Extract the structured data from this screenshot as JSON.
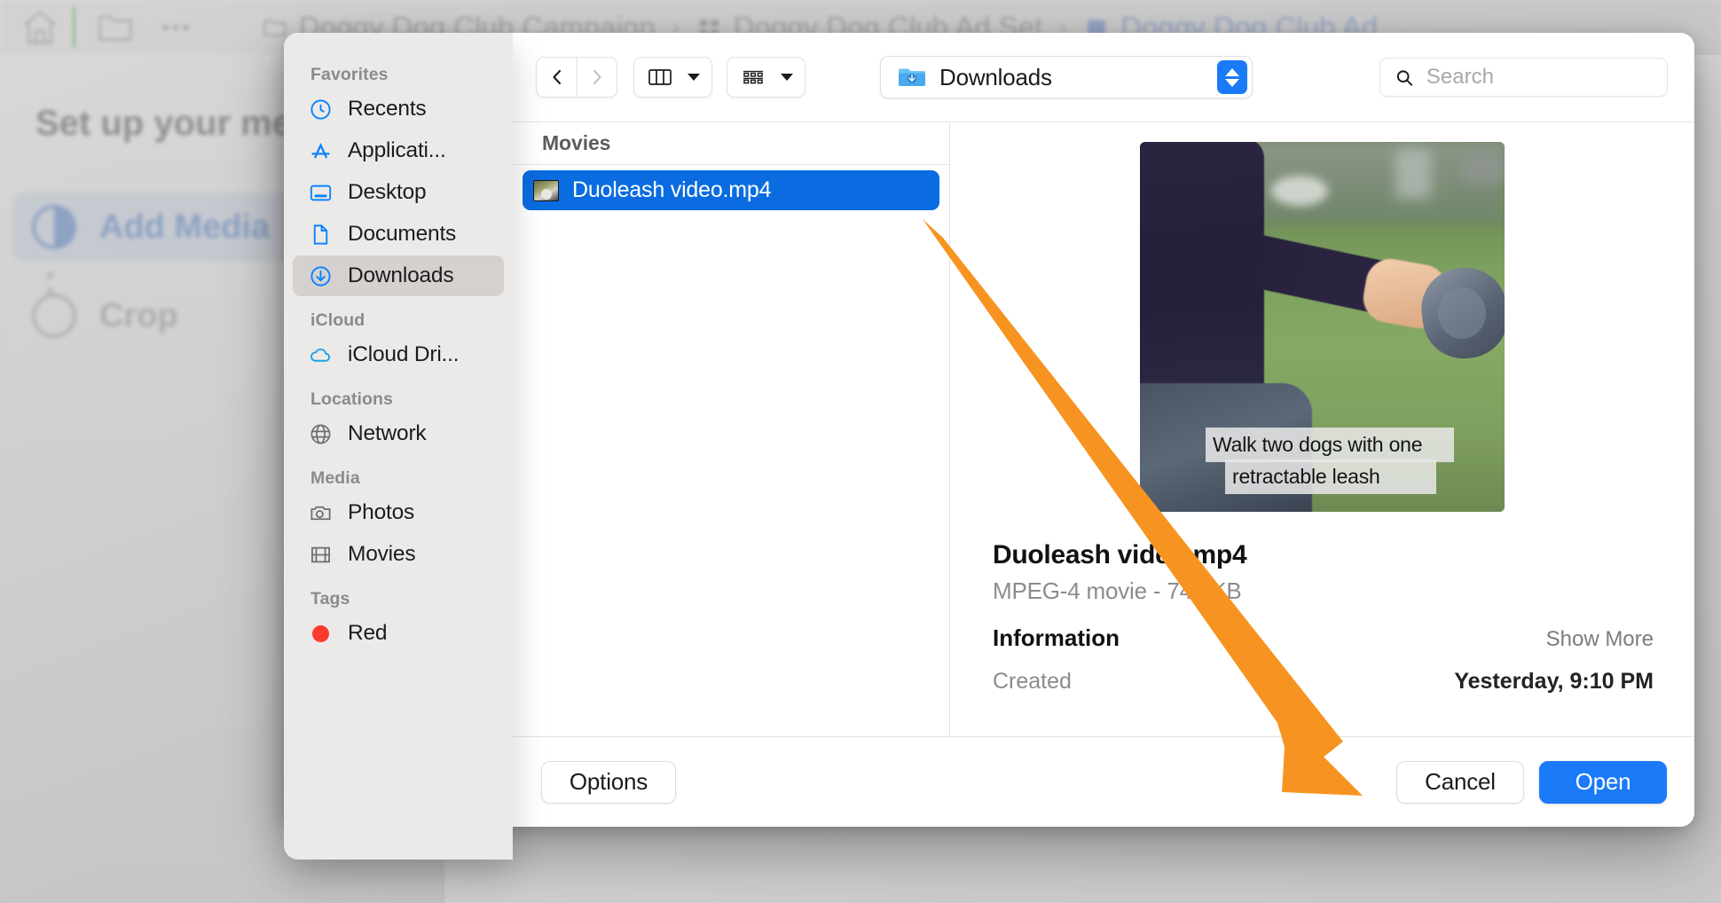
{
  "background_app": {
    "breadcrumb": [
      {
        "label": "Doggy Dog Club Campaign",
        "icon": "folder-icon"
      },
      {
        "label": "Doggy Dog Club Ad Set",
        "icon": "grid-icon"
      },
      {
        "label": "Doggy Dog Club Ad",
        "icon": "ad-icon"
      }
    ],
    "separator": "›",
    "panel_title": "Set up your med",
    "steps": [
      {
        "label": "Add Media",
        "state": "active"
      },
      {
        "label": "Crop",
        "state": "inactive"
      }
    ]
  },
  "dialog": {
    "sidebar": {
      "groups": [
        {
          "title": "Favorites",
          "items": [
            {
              "label": "Recents",
              "icon": "clock-icon",
              "active": false
            },
            {
              "label": "Applicati...",
              "icon": "appstore-icon",
              "active": false
            },
            {
              "label": "Desktop",
              "icon": "desktop-icon",
              "active": false
            },
            {
              "label": "Documents",
              "icon": "document-icon",
              "active": false
            },
            {
              "label": "Downloads",
              "icon": "download-icon",
              "active": true
            }
          ]
        },
        {
          "title": "iCloud",
          "items": [
            {
              "label": "iCloud Dri...",
              "icon": "cloud-icon",
              "active": false
            }
          ]
        },
        {
          "title": "Locations",
          "items": [
            {
              "label": "Network",
              "icon": "globe-icon",
              "active": false
            }
          ]
        },
        {
          "title": "Media",
          "items": [
            {
              "label": "Photos",
              "icon": "camera-icon",
              "active": false
            },
            {
              "label": "Movies",
              "icon": "film-icon",
              "active": false
            }
          ]
        },
        {
          "title": "Tags",
          "items": [
            {
              "label": "Red",
              "icon": "red-tag-dot",
              "active": false
            }
          ]
        }
      ]
    },
    "toolbar": {
      "back_icon": "chevron-left-icon",
      "forward_icon": "chevron-right-icon",
      "view_mode_icon": "column-view-icon",
      "view_mode_chevron": "chevron-down-icon",
      "group_by_icon": "group-by-icon",
      "group_by_chevron": "chevron-down-icon",
      "path_label": "Downloads",
      "path_icon": "downloads-folder-icon",
      "path_stepper_icon": "up-down-stepper-icon",
      "search_icon": "search-icon",
      "search_value": "",
      "search_placeholder": "Search"
    },
    "file_list": {
      "column_header": "Movies",
      "rows": [
        {
          "name": "Duoleash video.mp4",
          "icon": "video-thumbnail-icon",
          "selected": true
        }
      ]
    },
    "preview": {
      "media_caption_line1": "Walk two dogs with one",
      "media_caption_line2": "retractable leash",
      "file_name": "Duoleash video.mp4",
      "file_meta": "MPEG-4 movie - 748 KB",
      "section_title": "Information",
      "show_more": "Show More",
      "info_rows": [
        {
          "key": "Created",
          "value": "Yesterday, 9:10 PM"
        }
      ]
    },
    "buttons": {
      "options": "Options",
      "cancel": "Cancel",
      "open": "Open"
    }
  },
  "annotation": {
    "arrow_color": "#F79421",
    "arrow_points_to": "Open"
  },
  "colors": {
    "accent_blue": "#1A7AF8",
    "selection_blue": "#0A6CE0",
    "sidebar_bg": "#ECEAE8",
    "tag_red": "#FC3B30",
    "arrow_orange": "#F79421"
  }
}
